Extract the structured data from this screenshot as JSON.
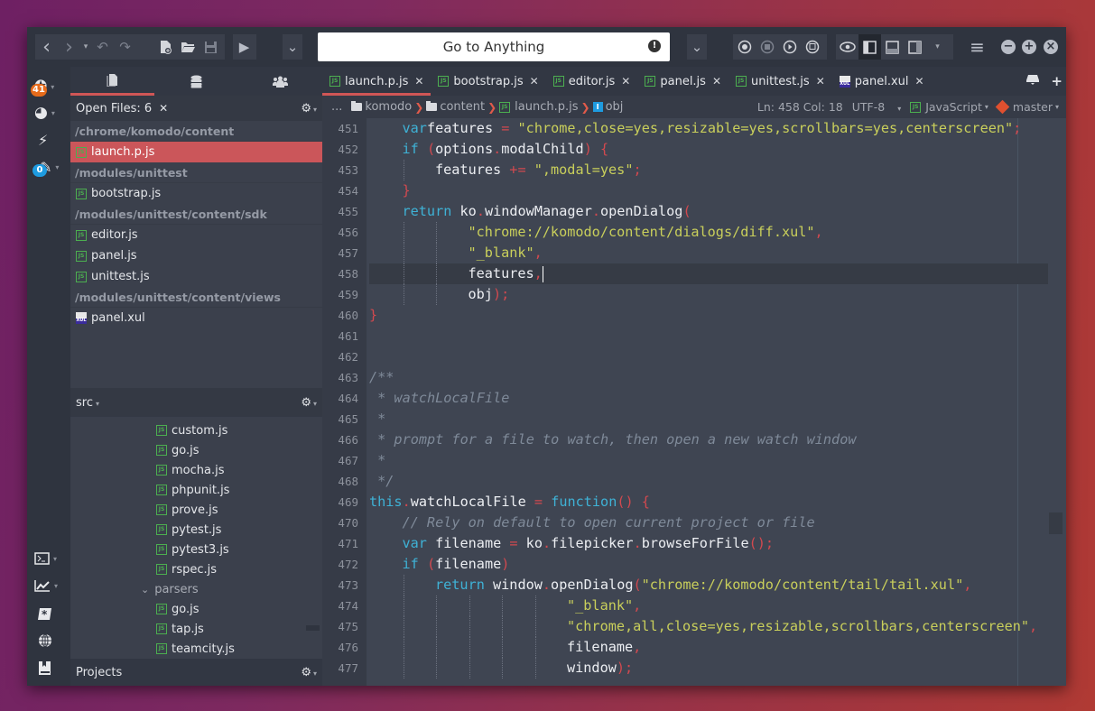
{
  "toolbar": {
    "nav": [
      {
        "name": "back-icon",
        "glyph": "‹"
      },
      {
        "name": "forward-icon",
        "glyph": "›"
      },
      {
        "name": "undo-icon",
        "glyph": "↶"
      },
      {
        "name": "redo-icon",
        "glyph": "↷"
      }
    ],
    "file": [
      {
        "name": "new-file-icon",
        "glyph": "🗋"
      },
      {
        "name": "open-folder-icon",
        "glyph": "📂"
      },
      {
        "name": "save-icon",
        "glyph": "💾"
      }
    ],
    "run_glyph": "▶",
    "more_glyph": "⌄",
    "goto_placeholder": "Go to Anything",
    "goto_warn_glyph": "!",
    "macro": [
      {
        "name": "record-macro-icon",
        "glyph": "◉"
      },
      {
        "name": "stop-macro-icon",
        "glyph": "◎"
      },
      {
        "name": "play-macro-icon",
        "glyph": "⊙"
      },
      {
        "name": "save-macro-icon",
        "glyph": "⊚"
      }
    ],
    "layout": [
      {
        "name": "preview-eye-icon",
        "glyph": "👁"
      },
      {
        "name": "left-pane-toggle-icon",
        "glyph": "◧"
      },
      {
        "name": "bottom-pane-toggle-icon",
        "glyph": "⬓"
      },
      {
        "name": "right-pane-toggle-icon",
        "glyph": "◨"
      }
    ],
    "menu_glyph": "≡",
    "window_controls": [
      {
        "name": "minimize-icon",
        "glyph": "−"
      },
      {
        "name": "maximize-icon",
        "glyph": "+"
      },
      {
        "name": "close-window-icon",
        "glyph": "×"
      }
    ]
  },
  "iconbar": {
    "items": [
      {
        "name": "notifications-icon",
        "glyph": "✪",
        "badge": "41",
        "badge_color": "#e66b1a",
        "caret": true
      },
      {
        "name": "globe-icon",
        "glyph": "◕",
        "caret": true
      },
      {
        "name": "lightning-icon",
        "glyph": "⚡"
      },
      {
        "name": "scc-icon",
        "glyph": "✎",
        "badge": "0",
        "badge_color": "#1e9be0",
        "caret": true
      },
      {
        "name": "terminal-icon",
        "glyph": "▣",
        "caret": true
      },
      {
        "name": "chart-icon",
        "glyph": "📈",
        "caret": true
      },
      {
        "name": "snippet-icon",
        "glyph": "✱"
      },
      {
        "name": "web-icon",
        "glyph": "🌐"
      },
      {
        "name": "bookmark-book-icon",
        "glyph": "📘"
      }
    ]
  },
  "left_pane": {
    "tabs": [
      {
        "name": "tab-open-files",
        "glyph": "🗐",
        "active": true
      },
      {
        "name": "tab-database",
        "glyph": "≣"
      },
      {
        "name": "tab-collaboration",
        "glyph": "👥"
      }
    ],
    "open_files": {
      "title": "Open Files: 6",
      "close_glyph": "✕",
      "groups": [
        {
          "path": "/chrome/komodo/content",
          "files": [
            {
              "name": "launch.p.js",
              "type": "js",
              "selected": true
            }
          ]
        },
        {
          "path": "/modules/unittest",
          "files": [
            {
              "name": "bootstrap.js",
              "type": "js"
            }
          ]
        },
        {
          "path": "/modules/unittest/content/sdk",
          "files": [
            {
              "name": "editor.js",
              "type": "js"
            },
            {
              "name": "panel.js",
              "type": "js"
            },
            {
              "name": "unittest.js",
              "type": "js"
            }
          ]
        },
        {
          "path": "/modules/unittest/content/views",
          "files": [
            {
              "name": "panel.xul",
              "type": "xul"
            }
          ]
        }
      ]
    },
    "project": {
      "root": "src",
      "items": [
        {
          "label": "custom.js",
          "type": "js",
          "indent": 2
        },
        {
          "label": "go.js",
          "type": "js",
          "indent": 2
        },
        {
          "label": "mocha.js",
          "type": "js",
          "indent": 2
        },
        {
          "label": "phpunit.js",
          "type": "js",
          "indent": 2
        },
        {
          "label": "prove.js",
          "type": "js",
          "indent": 2
        },
        {
          "label": "pytest.js",
          "type": "js",
          "indent": 2
        },
        {
          "label": "pytest3.js",
          "type": "js",
          "indent": 2
        },
        {
          "label": "rspec.js",
          "type": "js",
          "indent": 2
        },
        {
          "label": "parsers",
          "type": "folder",
          "indent": 1,
          "expanded": true
        },
        {
          "label": "go.js",
          "type": "js",
          "indent": 2
        },
        {
          "label": "tap.js",
          "type": "js",
          "indent": 2
        },
        {
          "label": "teamcity.js",
          "type": "js",
          "indent": 2
        }
      ],
      "footer_label": "Projects"
    }
  },
  "editor": {
    "tabs": [
      {
        "label": "launch.p.js",
        "type": "js",
        "active": true
      },
      {
        "label": "bootstrap.js",
        "type": "js"
      },
      {
        "label": "editor.js",
        "type": "js"
      },
      {
        "label": "panel.js",
        "type": "js"
      },
      {
        "label": "unittest.js",
        "type": "js"
      },
      {
        "label": "panel.xul",
        "type": "xul"
      }
    ],
    "tab_close_glyph": "✕",
    "breadcrumb": {
      "ellipsis": "...",
      "items": [
        {
          "label": "komodo",
          "type": "folder"
        },
        {
          "label": "content",
          "type": "folder"
        },
        {
          "label": "launch.p.js",
          "type": "js"
        },
        {
          "label": "obj",
          "type": "symbol"
        }
      ]
    },
    "status": {
      "position": "Ln: 458 Col: 18",
      "encoding": "UTF-8",
      "language": "JavaScript",
      "branch": "master"
    },
    "current_line": 458,
    "lines": [
      {
        "n": "451",
        "indent": 1,
        "tokens": [
          [
            "kw",
            "var"
          ],
          [
            "",
            "features "
          ],
          [
            "op",
            "="
          ],
          [
            "str",
            " \"chrome,close=yes,resizable=yes,scrollbars=yes,centerscreen\""
          ],
          [
            "punc",
            ";"
          ]
        ]
      },
      {
        "n": "452",
        "indent": 1,
        "tokens": [
          [
            "kw",
            "if"
          ],
          [
            "punc",
            " ("
          ],
          [
            "",
            "options"
          ],
          [
            "punc",
            "."
          ],
          [
            "",
            "modalChild"
          ],
          [
            "punc",
            ")"
          ],
          [
            "punc",
            " {"
          ]
        ]
      },
      {
        "n": "453",
        "indent": 2,
        "tokens": [
          [
            "",
            "features "
          ],
          [
            "op",
            "+="
          ],
          [
            "str",
            " \",modal=yes\""
          ],
          [
            "punc",
            ";"
          ]
        ]
      },
      {
        "n": "454",
        "indent": 1,
        "tokens": [
          [
            "punc",
            "}"
          ]
        ]
      },
      {
        "n": "455",
        "indent": 1,
        "tokens": [
          [
            "kw",
            "return"
          ],
          [
            "",
            " ko"
          ],
          [
            "punc",
            "."
          ],
          [
            "",
            "windowManager"
          ],
          [
            "punc",
            "."
          ],
          [
            "",
            "openDialog"
          ],
          [
            "punc",
            "("
          ]
        ]
      },
      {
        "n": "456",
        "indent": 3,
        "tokens": [
          [
            "str",
            "\"chrome://komodo/content/dialogs/diff.xul\""
          ],
          [
            "punc",
            ","
          ]
        ]
      },
      {
        "n": "457",
        "indent": 3,
        "tokens": [
          [
            "str",
            "\"_blank\""
          ],
          [
            "punc",
            ","
          ]
        ]
      },
      {
        "n": "458",
        "indent": 3,
        "tokens": [
          [
            "",
            "features"
          ],
          [
            "punc",
            ","
          ]
        ],
        "cursor": true
      },
      {
        "n": "459",
        "indent": 3,
        "tokens": [
          [
            "",
            "obj"
          ],
          [
            "punc",
            ")"
          ],
          [
            "punc",
            ";"
          ]
        ]
      },
      {
        "n": "460",
        "indent": 0,
        "tokens": [
          [
            "punc",
            "}"
          ]
        ]
      },
      {
        "n": "461",
        "indent": 0,
        "tokens": []
      },
      {
        "n": "462",
        "indent": 0,
        "tokens": []
      },
      {
        "n": "463",
        "indent": 0,
        "tokens": [
          [
            "cmt",
            "/**"
          ]
        ]
      },
      {
        "n": "464",
        "indent": 0,
        "tokens": [
          [
            "cmt",
            " * watchLocalFile"
          ]
        ]
      },
      {
        "n": "465",
        "indent": 0,
        "tokens": [
          [
            "cmt",
            " *"
          ]
        ]
      },
      {
        "n": "466",
        "indent": 0,
        "tokens": [
          [
            "cmt",
            " * prompt for a file to watch, then open a new watch window"
          ]
        ]
      },
      {
        "n": "467",
        "indent": 0,
        "tokens": [
          [
            "cmt",
            " *"
          ]
        ]
      },
      {
        "n": "468",
        "indent": 0,
        "tokens": [
          [
            "cmt",
            " */"
          ]
        ]
      },
      {
        "n": "469",
        "indent": 0,
        "tokens": [
          [
            "kw",
            "this"
          ],
          [
            "punc",
            "."
          ],
          [
            "",
            "watchLocalFile "
          ],
          [
            "op",
            "="
          ],
          [
            "kw",
            " function"
          ],
          [
            "punc",
            "()"
          ],
          [
            "punc",
            " {"
          ]
        ]
      },
      {
        "n": "470",
        "indent": 1,
        "tokens": [
          [
            "cmt",
            "// Rely on default to open current project or file"
          ]
        ]
      },
      {
        "n": "471",
        "indent": 1,
        "tokens": [
          [
            "kw",
            "var"
          ],
          [
            "",
            " filename "
          ],
          [
            "op",
            "="
          ],
          [
            "",
            " ko"
          ],
          [
            "punc",
            "."
          ],
          [
            "",
            "filepicker"
          ],
          [
            "punc",
            "."
          ],
          [
            "",
            "browseForFile"
          ],
          [
            "punc",
            "()"
          ],
          [
            "punc",
            ";"
          ]
        ]
      },
      {
        "n": "472",
        "indent": 1,
        "tokens": [
          [
            "kw",
            "if"
          ],
          [
            "punc",
            " ("
          ],
          [
            "",
            "filename"
          ],
          [
            "punc",
            ")"
          ]
        ]
      },
      {
        "n": "473",
        "indent": 2,
        "tokens": [
          [
            "kw",
            "return"
          ],
          [
            "",
            " window"
          ],
          [
            "punc",
            "."
          ],
          [
            "",
            "openDialog"
          ],
          [
            "punc",
            "("
          ],
          [
            "str",
            "\"chrome://komodo/content/tail/tail.xul\""
          ],
          [
            "punc",
            ","
          ]
        ]
      },
      {
        "n": "474",
        "indent": 6,
        "tokens": [
          [
            "str",
            "\"_blank\""
          ],
          [
            "punc",
            ","
          ]
        ]
      },
      {
        "n": "475",
        "indent": 6,
        "tokens": [
          [
            "str",
            "\"chrome,all,close=yes,resizable,scrollbars,centerscreen\""
          ],
          [
            "punc",
            ","
          ]
        ]
      },
      {
        "n": "476",
        "indent": 6,
        "tokens": [
          [
            "",
            "filename"
          ],
          [
            "punc",
            ","
          ]
        ]
      },
      {
        "n": "477",
        "indent": 6,
        "tokens": [
          [
            "",
            "window"
          ],
          [
            "punc",
            ")"
          ],
          [
            "punc",
            ";"
          ]
        ]
      }
    ]
  }
}
